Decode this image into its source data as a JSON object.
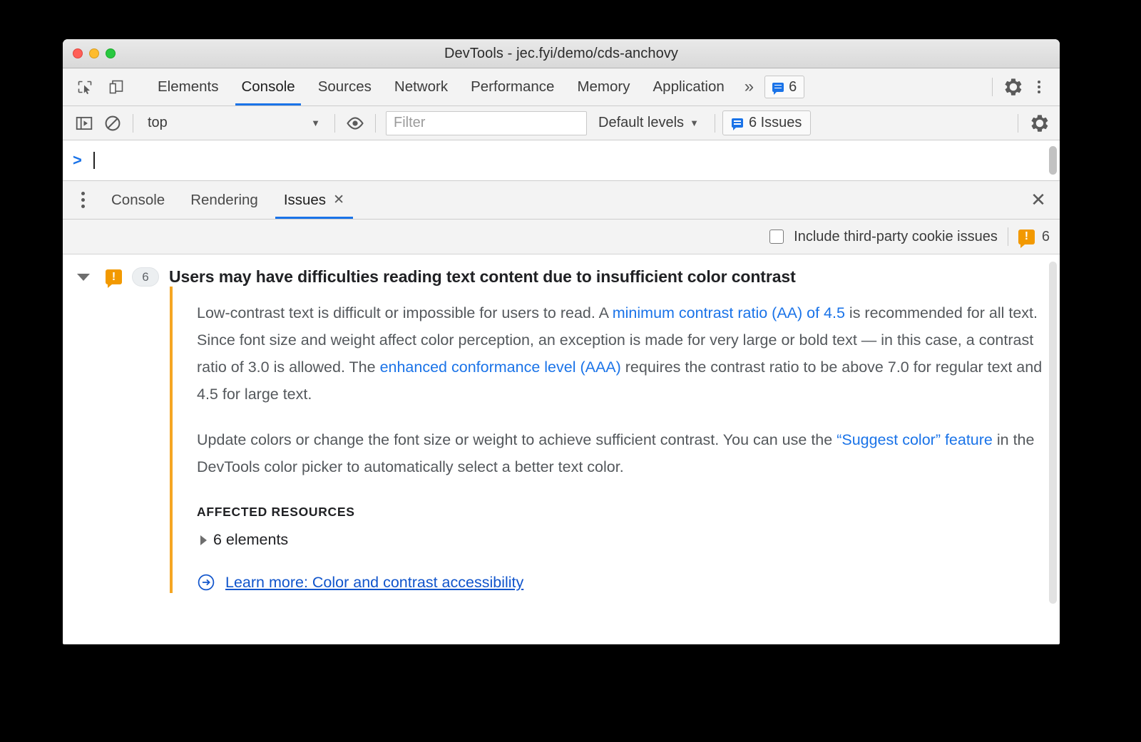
{
  "window": {
    "title": "DevTools - jec.fyi/demo/cds-anchovy",
    "traffic_lights": [
      "close",
      "minimize",
      "zoom"
    ]
  },
  "main_tabbar": {
    "icons": [
      {
        "name": "inspect-element-icon",
        "label": "Inspect element"
      },
      {
        "name": "device-toolbar-icon",
        "label": "Toggle device toolbar"
      }
    ],
    "tabs": [
      {
        "label": "Elements",
        "active": false
      },
      {
        "label": "Console",
        "active": true
      },
      {
        "label": "Sources",
        "active": false
      },
      {
        "label": "Network",
        "active": false
      },
      {
        "label": "Performance",
        "active": false
      },
      {
        "label": "Memory",
        "active": false
      },
      {
        "label": "Application",
        "active": false
      }
    ],
    "more_tabs_label": "»",
    "issues_badge_count": "6",
    "settings_label": "Settings",
    "more_options_label": "Customize and control DevTools"
  },
  "console_toolbar": {
    "sidebar_toggle_label": "Show console sidebar",
    "clear_label": "Clear console",
    "context_selected": "top",
    "context_caret": "▼",
    "live_expression_label": "Create live expression",
    "filter_placeholder": "Filter",
    "filter_value": "",
    "levels_label": "Default levels",
    "levels_caret": "▼",
    "issues_button_label": "6 Issues",
    "settings_label": "Console settings"
  },
  "console_prompt": {
    "prompt_symbol": ">",
    "input_value": ""
  },
  "drawer": {
    "more_tools_label": "More tools",
    "tabs": [
      {
        "label": "Console",
        "active": false,
        "closable": false
      },
      {
        "label": "Rendering",
        "active": false,
        "closable": false
      },
      {
        "label": "Issues",
        "active": true,
        "closable": true,
        "close_glyph": "✕"
      }
    ],
    "close_drawer_glyph": "✕"
  },
  "issues_header": {
    "third_party_checkbox_label": "Include third-party cookie issues",
    "third_party_checked": false,
    "warning_count": "6",
    "warning_icon": "warning-bubble-icon"
  },
  "issue": {
    "expanded": true,
    "expander_glyph": "▼",
    "icon": "warning-bubble-icon",
    "count": "6",
    "title": "Users may have difficulties reading text content due to insufficient color contrast",
    "paragraph1": {
      "seg1": "Low-contrast text is difficult or impossible for users to read. A ",
      "link1": "minimum contrast ratio (AA) of 4.5",
      "seg2": " is recommended for all text. Since font size and weight affect color perception, an exception is made for very large or bold text — in this case, a contrast ratio of 3.0 is allowed. The ",
      "link2": "enhanced conformance level (AAA)",
      "seg3": " requires the contrast ratio to be above 7.0 for regular text and 4.5 for large text."
    },
    "paragraph2": {
      "seg1": "Update colors or change the font size or weight to achieve sufficient contrast. You can use the ",
      "link1": "“Suggest color” feature",
      "seg2": " in the DevTools color picker to automatically select a better text color."
    },
    "affected_resources_label": "AFFECTED RESOURCES",
    "affected_resources_value": "6 elements",
    "affected_expander_glyph": "▶",
    "learn_more_label": "Learn more: Color and contrast accessibility",
    "learn_more_icon": "arrow-circle-icon"
  },
  "colors": {
    "accent_blue": "#1a73e8",
    "link_blue": "#1155cc",
    "warning_orange": "#f29900",
    "issue_bar_orange": "#f5a623",
    "text_gray": "#54585c"
  }
}
